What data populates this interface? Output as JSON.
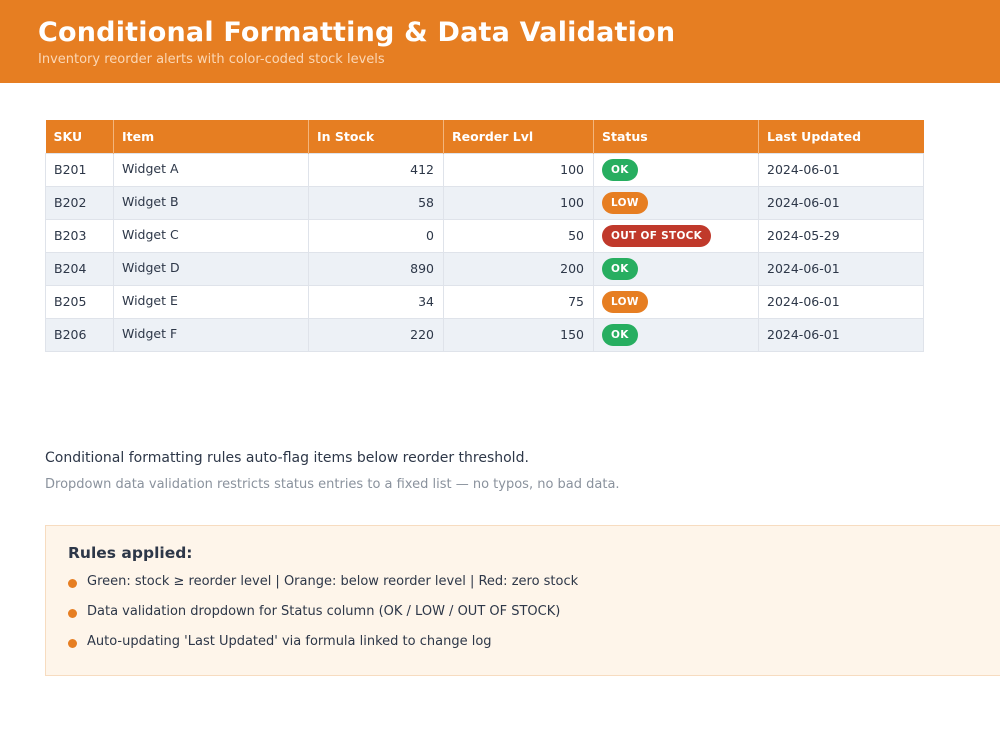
{
  "header": {
    "title": "Conditional Formatting & Data Validation",
    "subtitle": "Inventory reorder alerts with color-coded stock levels"
  },
  "colors": {
    "accent": "#e67e22",
    "ok": "#27ae60",
    "low": "#e67e22",
    "out": "#c0392b"
  },
  "table": {
    "columns": [
      "SKU",
      "Item",
      "In Stock",
      "Reorder Lvl",
      "Status",
      "Last Updated"
    ],
    "rows": [
      {
        "sku": "B201",
        "item": "Widget A",
        "in_stock": "412",
        "reorder": "100",
        "status": "OK",
        "updated": "2024-06-01"
      },
      {
        "sku": "B202",
        "item": "Widget B",
        "in_stock": "58",
        "reorder": "100",
        "status": "LOW",
        "updated": "2024-06-01"
      },
      {
        "sku": "B203",
        "item": "Widget C",
        "in_stock": "0",
        "reorder": "50",
        "status": "OUT OF STOCK",
        "updated": "2024-05-29"
      },
      {
        "sku": "B204",
        "item": "Widget D",
        "in_stock": "890",
        "reorder": "200",
        "status": "OK",
        "updated": "2024-06-01"
      },
      {
        "sku": "B205",
        "item": "Widget E",
        "in_stock": "34",
        "reorder": "75",
        "status": "LOW",
        "updated": "2024-06-01"
      },
      {
        "sku": "B206",
        "item": "Widget F",
        "in_stock": "220",
        "reorder": "150",
        "status": "OK",
        "updated": "2024-06-01"
      }
    ]
  },
  "notes": {
    "primary": "Conditional formatting rules auto-flag items below reorder threshold.",
    "secondary": "Dropdown data validation restricts status entries to a fixed list — no typos, no bad data."
  },
  "rules": {
    "title": "Rules applied:",
    "items": [
      "Green: stock ≥ reorder level  |  Orange: below reorder level  |  Red: zero stock",
      "Data validation dropdown for Status column (OK / LOW / OUT OF STOCK)",
      "Auto-updating 'Last Updated' via formula linked to change log"
    ]
  }
}
